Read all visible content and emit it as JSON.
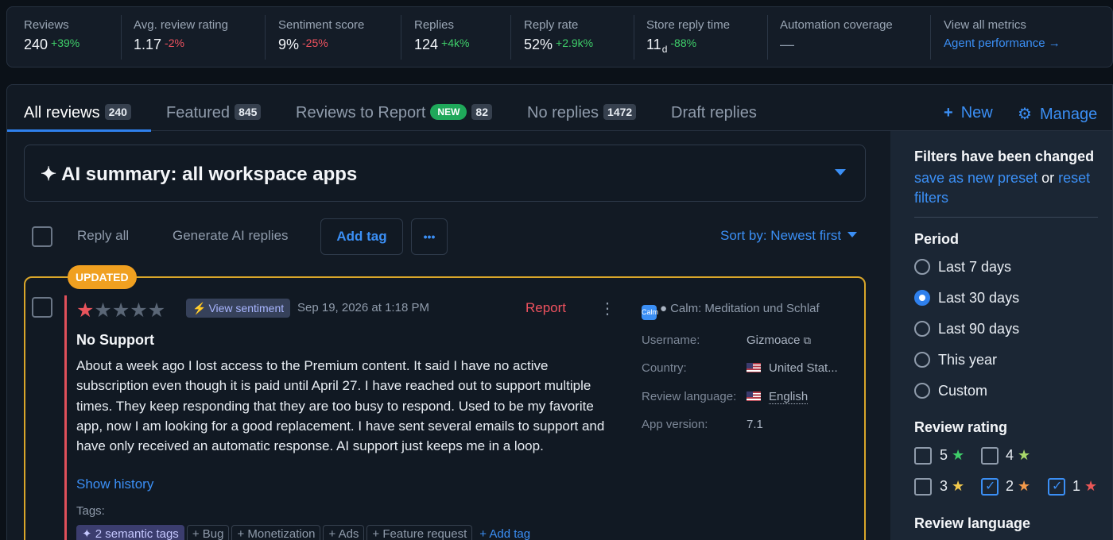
{
  "metrics": [
    {
      "label": "Reviews",
      "value": "240",
      "change": "+39%",
      "dir": "up"
    },
    {
      "label": "Avg. review rating",
      "value": "1.17",
      "change": "-2%",
      "dir": "down"
    },
    {
      "label": "Sentiment score",
      "value": "9%",
      "change": "-25%",
      "dir": "down"
    },
    {
      "label": "Replies",
      "value": "124",
      "change": "+4k%",
      "dir": "up"
    },
    {
      "label": "Reply rate",
      "value": "52%",
      "change": "+2.9k%",
      "dir": "up"
    },
    {
      "label": "Store reply time",
      "value": "11",
      "unit": "d",
      "change": "-88%",
      "dir": "up"
    },
    {
      "label": "Automation coverage",
      "value": "—"
    },
    {
      "label": "View all metrics",
      "link": "Agent performance →"
    }
  ],
  "tabs": [
    {
      "label": "All reviews",
      "count": "240"
    },
    {
      "label": "Featured",
      "count": "845"
    },
    {
      "label": "Reviews to Report",
      "badge": "NEW",
      "count": "82"
    },
    {
      "label": "No replies",
      "count": "1472"
    },
    {
      "label": "Draft replies"
    }
  ],
  "tab_actions": {
    "new": "New",
    "manage": "Manage"
  },
  "ai_summary": {
    "title": "AI summary: all workspace apps"
  },
  "toolbar": {
    "reply_all": "Reply all",
    "generate": "Generate AI replies",
    "add_tag": "Add tag",
    "more": "•••",
    "sort": "Sort by: Newest first"
  },
  "review": {
    "badge": "UPDATED",
    "rating": 1,
    "stars": [
      "★",
      "★",
      "★",
      "★",
      "★"
    ],
    "view_sentiment": "View sentiment",
    "date": "Sep 19, 2026 at 1:18 PM",
    "report": "Report",
    "kebab": "⋮",
    "title": "No Support",
    "body": "About a week ago I lost access to the Premium content. It said I have no active subscription even though it is paid until April 27. I have reached out to support multiple times. They keep responding that they are too busy to respond. Used to be my favorite app, now I am looking for a good replacement. I have sent several emails to support and have only received an automatic response. AI support just keeps me in a loop.",
    "show_history": "Show history",
    "tags_label": "Tags:",
    "tags": {
      "semantic": "2 semantic tags",
      "items": [
        "Bug",
        "Monetization",
        "Ads",
        "Feature request"
      ],
      "add": "Add tag"
    },
    "app": {
      "icon": "Calm",
      "name": "Calm: Meditation und Schlaf"
    },
    "meta": [
      {
        "label": "Username:",
        "value": "Gizmoace"
      },
      {
        "label": "Country:",
        "value": "United Stat..."
      },
      {
        "label": "Review language:",
        "value": "English"
      },
      {
        "label": "App version:",
        "value": "7.1"
      }
    ]
  },
  "sidebar": {
    "changed_title": "Filters have been changed",
    "save_preset": "save as new preset",
    "or": "or",
    "reset": "reset filters",
    "period_title": "Period",
    "periods": [
      "Last 7 days",
      "Last 30 days",
      "Last 90 days",
      "This year",
      "Custom"
    ],
    "period_selected": "Last 30 days",
    "rating_title": "Review rating",
    "ratings": [
      "5",
      "4",
      "3",
      "2",
      "1"
    ],
    "language_title": "Review language"
  },
  "colors": {
    "accent": "#3b8ff5",
    "positive": "#3fcf6a",
    "negative": "#f0525f",
    "updated": "#f0a020"
  }
}
